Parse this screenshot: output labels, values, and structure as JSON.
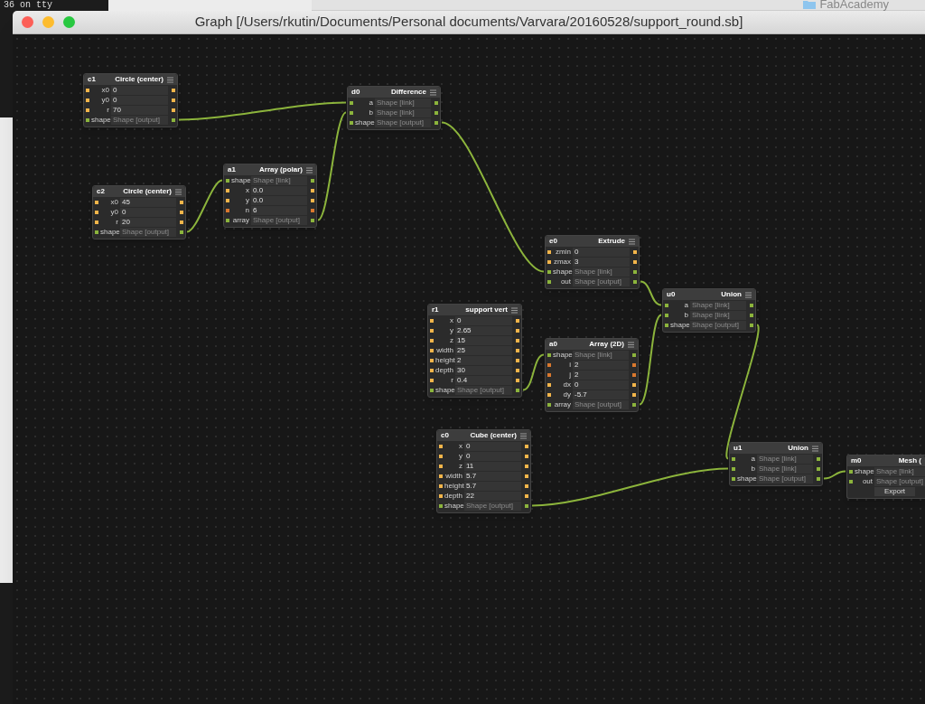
{
  "background": {
    "terminal_text": "36 on tty",
    "finder_title": "FabAcademy"
  },
  "window": {
    "title": "Graph [/Users/rkutin/Documents/Personal documents/Varvara/20160528/support_round.sb]"
  },
  "nodes": [
    {
      "name": "c1",
      "title": "Circle (center)",
      "rows": [
        {
          "label": "x0",
          "value": "0",
          "kind": "float"
        },
        {
          "label": "y0",
          "value": "0",
          "kind": "float"
        },
        {
          "label": "r",
          "value": "70",
          "kind": "float"
        },
        {
          "label": "shape",
          "placeholder": "Shape [output]",
          "kind": "output"
        }
      ]
    },
    {
      "name": "d0",
      "title": "Difference",
      "rows": [
        {
          "label": "a",
          "placeholder": "Shape [link]",
          "kind": "link"
        },
        {
          "label": "b",
          "placeholder": "Shape [link]",
          "kind": "link"
        },
        {
          "label": "shape",
          "placeholder": "Shape [output]",
          "kind": "output"
        }
      ]
    },
    {
      "name": "c2",
      "title": "Circle (center)",
      "rows": [
        {
          "label": "x0",
          "value": "45",
          "kind": "float"
        },
        {
          "label": "y0",
          "value": "0",
          "kind": "float"
        },
        {
          "label": "r",
          "value": "20",
          "kind": "float"
        },
        {
          "label": "shape",
          "placeholder": "Shape [output]",
          "kind": "output"
        }
      ]
    },
    {
      "name": "a1",
      "title": "Array (polar)",
      "rows": [
        {
          "label": "shape",
          "placeholder": "Shape [link]",
          "kind": "link"
        },
        {
          "label": "x",
          "value": "0.0",
          "kind": "float"
        },
        {
          "label": "y",
          "value": "0.0",
          "kind": "float"
        },
        {
          "label": "n",
          "value": "6",
          "kind": "int"
        },
        {
          "label": "array",
          "placeholder": "Shape [output]",
          "kind": "output"
        }
      ]
    },
    {
      "name": "e0",
      "title": "Extrude",
      "rows": [
        {
          "label": "zmin",
          "value": "0",
          "kind": "float"
        },
        {
          "label": "zmax",
          "value": "3",
          "kind": "float"
        },
        {
          "label": "shape",
          "placeholder": "Shape [link]",
          "kind": "link"
        },
        {
          "label": "out",
          "placeholder": "Shape [output]",
          "kind": "output"
        }
      ]
    },
    {
      "name": "u0",
      "title": "Union",
      "rows": [
        {
          "label": "a",
          "placeholder": "Shape [link]",
          "kind": "link"
        },
        {
          "label": "b",
          "placeholder": "Shape [link]",
          "kind": "link"
        },
        {
          "label": "shape",
          "placeholder": "Shape [output]",
          "kind": "output"
        }
      ]
    },
    {
      "name": "r1",
      "title": "support vert",
      "rows": [
        {
          "label": "x",
          "value": "0",
          "kind": "float"
        },
        {
          "label": "y",
          "value": "2.65",
          "kind": "float"
        },
        {
          "label": "z",
          "value": "15",
          "kind": "float"
        },
        {
          "label": "width",
          "value": "25",
          "kind": "float"
        },
        {
          "label": "height",
          "value": "2",
          "kind": "float"
        },
        {
          "label": "depth",
          "value": "30",
          "kind": "float"
        },
        {
          "label": "r",
          "value": "0.4",
          "kind": "float"
        },
        {
          "label": "shape",
          "placeholder": "Shape [output]",
          "kind": "output"
        }
      ]
    },
    {
      "name": "a0",
      "title": "Array (2D)",
      "rows": [
        {
          "label": "shape",
          "placeholder": "Shape [link]",
          "kind": "link"
        },
        {
          "label": "i",
          "value": "2",
          "kind": "int"
        },
        {
          "label": "j",
          "value": "2",
          "kind": "int"
        },
        {
          "label": "dx",
          "value": "0",
          "kind": "float"
        },
        {
          "label": "dy",
          "value": "-5.7",
          "kind": "float"
        },
        {
          "label": "array",
          "placeholder": "Shape [output]",
          "kind": "output"
        }
      ]
    },
    {
      "name": "c0",
      "title": "Cube (center)",
      "rows": [
        {
          "label": "x",
          "value": "0",
          "kind": "float"
        },
        {
          "label": "y",
          "value": "0",
          "kind": "float"
        },
        {
          "label": "z",
          "value": "11",
          "kind": "float"
        },
        {
          "label": "width",
          "value": "5.7",
          "kind": "float"
        },
        {
          "label": "height",
          "value": "5.7",
          "kind": "float"
        },
        {
          "label": "depth",
          "value": "22",
          "kind": "float"
        },
        {
          "label": "shape",
          "placeholder": "Shape [output]",
          "kind": "output"
        }
      ]
    },
    {
      "name": "u1",
      "title": "Union",
      "rows": [
        {
          "label": "a",
          "placeholder": "Shape [link]",
          "kind": "link"
        },
        {
          "label": "b",
          "placeholder": "Shape [link]",
          "kind": "link"
        },
        {
          "label": "shape",
          "placeholder": "Shape [output]",
          "kind": "output"
        }
      ]
    },
    {
      "name": "m0",
      "title": "Mesh (",
      "rows": [
        {
          "label": "shape",
          "placeholder": "Shape [link]",
          "kind": "link"
        },
        {
          "label": "out",
          "placeholder": "Shape [output]",
          "kind": "output"
        }
      ],
      "button": "Export"
    }
  ]
}
